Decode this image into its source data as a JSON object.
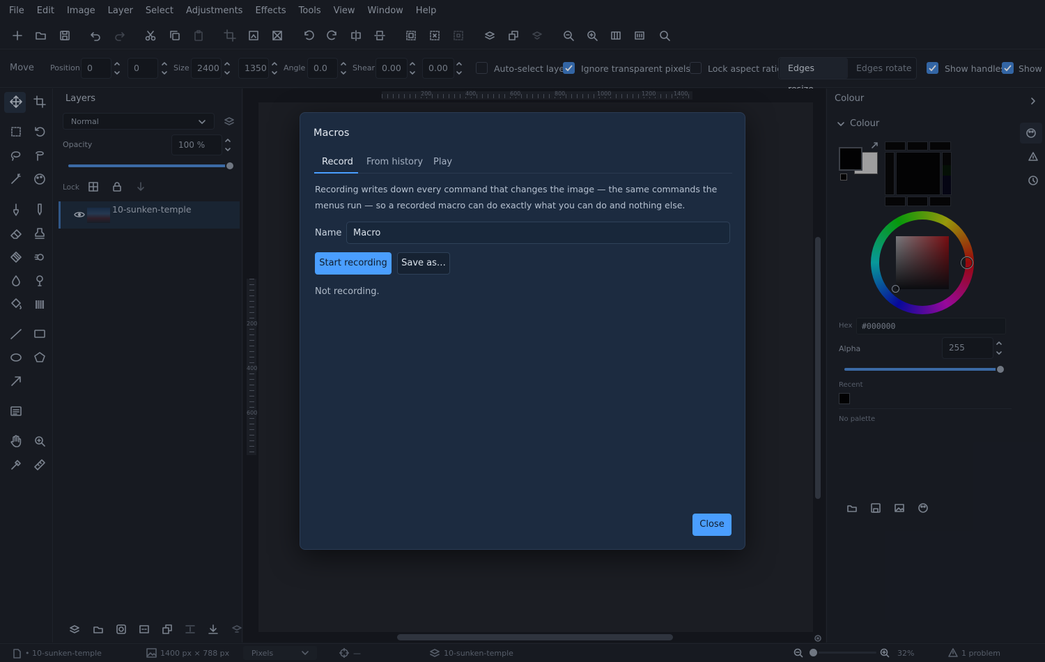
{
  "menubar": {
    "items": [
      "File",
      "Edit",
      "Image",
      "Layer",
      "Select",
      "Adjustments",
      "Effects",
      "Tools",
      "View",
      "Window",
      "Help"
    ]
  },
  "toolbar": {
    "icons": [
      "new-icon",
      "open-icon",
      "save-icon",
      "undo-icon",
      "redo-icon",
      "cut-icon",
      "copy-icon",
      "paste-icon",
      "crop-icon",
      "crop-to-selection-icon",
      "canvas-icon",
      "rotate-left-icon",
      "rotate-right-icon",
      "flip-horizontal-icon",
      "flip-vertical-icon",
      "select-all-icon",
      "deselect-icon",
      "invert-selection-icon",
      "layers-add-icon",
      "duplicate-icon",
      "merge-icon",
      "zoom-out-icon",
      "zoom-in-icon",
      "fit-icon",
      "actual-size-icon",
      "search-icon"
    ]
  },
  "options": {
    "tool_name": "Move",
    "position_label": "Position",
    "position_x": "0",
    "position_y": "0",
    "size_label": "Size",
    "size_w": "2400",
    "size_h": "1350",
    "angle_label": "Angle",
    "angle": "0.0",
    "shear_label": "Shear",
    "shear_x": "0.00",
    "shear_y": "0.00",
    "auto_select_label": "Auto-select layer",
    "ignore_transparent_label": "Ignore transparent pixels",
    "lock_aspect_label": "Lock aspect ratio",
    "edges_resize_label": "Edges resize",
    "edges_rotate_label": "Edges rotate",
    "show_handles_label": "Show handles",
    "show_label": "Show"
  },
  "tools": [
    "move-tool-icon",
    "crop-tool-icon",
    "rect-select-icon",
    "lasso-rotate-icon",
    "lasso-icon",
    "magic-lasso-icon",
    "magic-wand-icon",
    "color-picker-icon",
    "brush-icon",
    "pencil-icon",
    "eraser-icon",
    "clone-stamp-icon",
    "fill-icon",
    "smudge-icon",
    "dodge-icon",
    "burn-icon",
    "bucket-icon",
    "gradient-icon",
    "line-icon",
    "rectangle-icon",
    "ellipse-icon",
    "polygon-icon",
    "arrow-icon",
    "text-icon",
    "hand-icon",
    "zoom-icon",
    "eyedropper-icon",
    "measure-icon"
  ],
  "layers": {
    "title": "Layers",
    "blend_mode": "Normal",
    "opacity_label": "Opacity",
    "opacity_value": "100 %",
    "opacity_level": 1.0,
    "lock_label": "Lock",
    "items": [
      {
        "name": "10-sunken-temple",
        "visible": true
      }
    ]
  },
  "ruler": {
    "top": [
      "200",
      "400",
      "600",
      "800",
      "1000",
      "1200",
      "1400"
    ],
    "left": [
      "200",
      "400",
      "600"
    ]
  },
  "dialog": {
    "title": "Macros",
    "tabs": [
      "Record",
      "From history",
      "Play"
    ],
    "active_tab": "Record",
    "description": "Recording writes down every command that changes the image — the same commands the menus run — so a recorded macro can do exactly what you can do and nothing else.",
    "name_label": "Name",
    "name_value": "Macro",
    "start_label": "Start recording",
    "save_label": "Save as…",
    "status": "Not recording.",
    "close_label": "Close"
  },
  "colour": {
    "panel_title": "Colour",
    "section_title": "Colour",
    "hex_label": "Hex",
    "hex_value": "#000000",
    "alpha_label": "Alpha",
    "alpha_value": "255",
    "alpha_level": 1.0,
    "recent_label": "Recent",
    "palette_label": "No palette",
    "primary": "#000000",
    "secondary": "#c8c8c8"
  },
  "status": {
    "file": "• 10-sunken-temple",
    "dimensions": "1400 px × 788 px",
    "units": "Pixels",
    "cursor": "—",
    "layer": "10-sunken-temple",
    "zoom": "32%",
    "problems": "1 problem"
  },
  "colors": {
    "accent": "#4a9eff",
    "background": "#1a1e25",
    "dialog": "#1c2b40"
  }
}
